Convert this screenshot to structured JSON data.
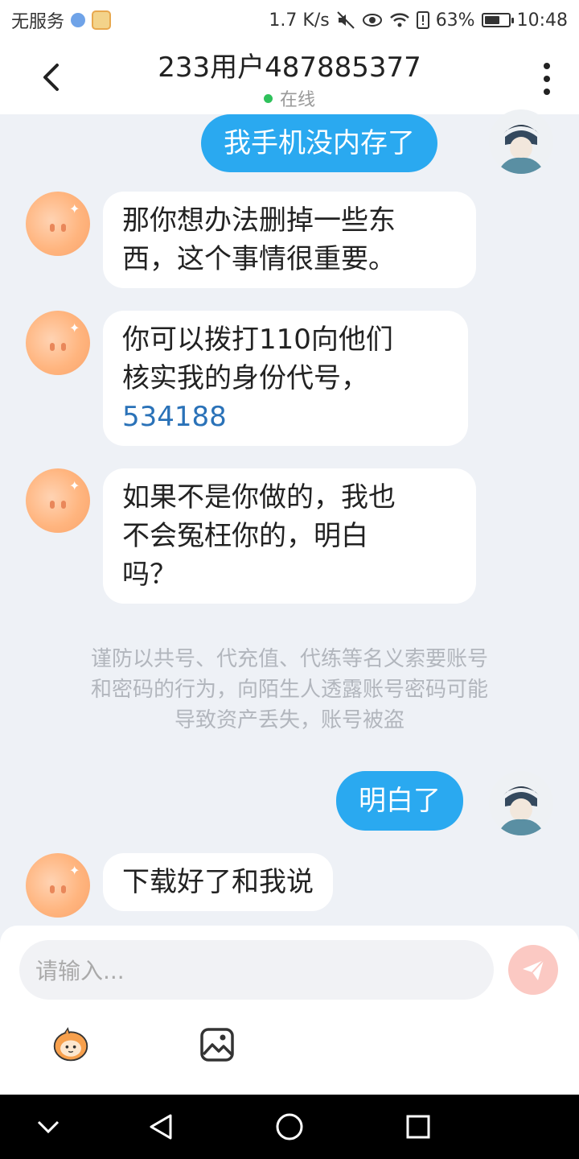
{
  "status_bar": {
    "carrier": "无服务",
    "speed": "1.7 K/s",
    "battery": "63%",
    "battery_level": 0.63,
    "time": "10:48"
  },
  "header": {
    "back_icon": "chevron-left-icon",
    "title": "233用户487885377",
    "status": "在线",
    "status_color": "#2fc15b",
    "more_icon": "more-vertical-icon"
  },
  "messages": [
    {
      "side": "out",
      "lines": [
        "我手机没内存了"
      ]
    },
    {
      "side": "in",
      "lines": [
        "那你想办法删掉一些东",
        "西，这个事情很重要。"
      ]
    },
    {
      "side": "in",
      "lines": [
        "你可以拨打110向他们",
        "核实我的身份代号，",
        "534188"
      ]
    },
    {
      "side": "in",
      "lines": [
        "如果不是你做的，我也",
        "不会冤枉你的，明白",
        "吗？"
      ]
    },
    {
      "side": "out",
      "lines": [
        "明白了"
      ]
    },
    {
      "side": "in",
      "lines": [
        "下载好了和我说"
      ]
    }
  ],
  "notice": {
    "lines": [
      "谨防以共号、代充值、代练等名义索要账号",
      "和密码的行为，向陌生人透露账号密码可能",
      "导致资产丢失，账号被盗"
    ]
  },
  "composer": {
    "placeholder": "请输入...",
    "send_icon": "send-icon",
    "emoji_icon": "mascot-sticker-icon",
    "image_icon": "image-icon"
  },
  "colors": {
    "accent": "#2aa9f0",
    "link": "#2a72b8",
    "background": "#eef1f6"
  }
}
